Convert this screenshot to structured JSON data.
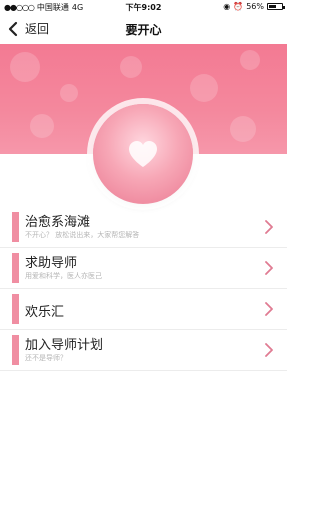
{
  "status_bar": {
    "carrier": "中国联通",
    "network": "4G",
    "time": "下午9:02",
    "battery_percent": "56%",
    "battery_level": 0.56
  },
  "nav": {
    "back_label": "返回",
    "title": "要开心"
  },
  "menu": [
    {
      "title": "治愈系海滩",
      "subtitle": "不开心？ 放松说出来，大家帮您解答"
    },
    {
      "title": "求助导师",
      "subtitle": "用爱和科学，医人亦医己"
    },
    {
      "title": "欢乐汇",
      "subtitle": ""
    },
    {
      "title": "加入导师计划",
      "subtitle": "还不是导师？"
    }
  ],
  "colors": {
    "accent": "#f08ea2",
    "hero": "#f37a93",
    "chevron": "#e07b92"
  },
  "icons": {
    "back": "chevron-left-icon",
    "row_arrow": "chevron-right-icon",
    "hero": "heart-icon"
  }
}
